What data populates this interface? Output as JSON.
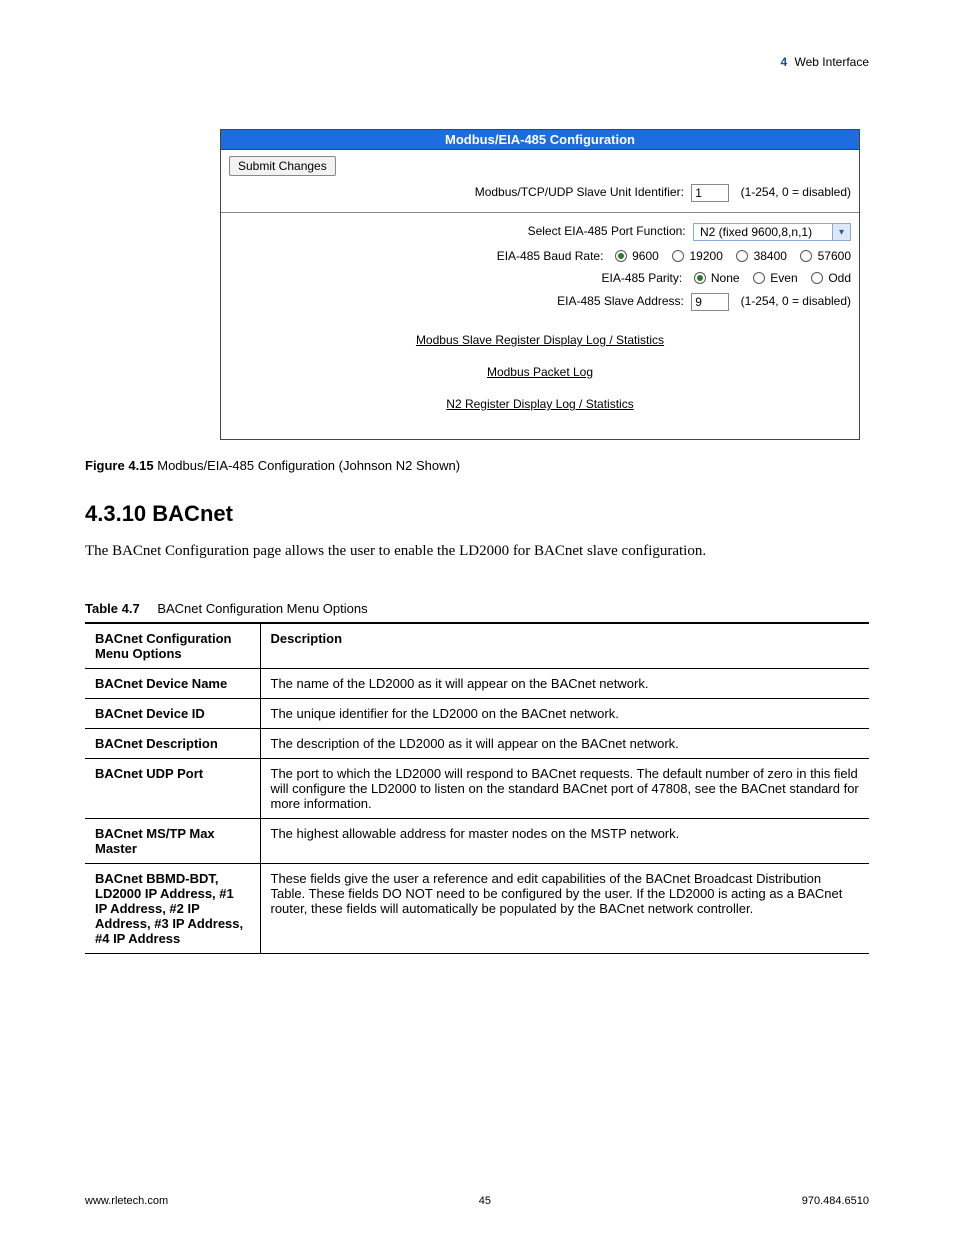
{
  "header": {
    "section_num": "4",
    "section_title": "Web Interface"
  },
  "figure": {
    "panel_title": "Modbus/EIA-485 Configuration",
    "submit_label": "Submit Changes",
    "modbus_id_label": "Modbus/TCP/UDP Slave Unit Identifier:",
    "modbus_id_value": "1",
    "modbus_id_hint": "(1-254, 0 = disabled)",
    "port_func_label": "Select EIA-485 Port Function:",
    "port_func_value": "N2 (fixed 9600,8,n,1)",
    "baud_label": "EIA-485 Baud Rate:",
    "baud_opts": [
      "9600",
      "19200",
      "38400",
      "57600"
    ],
    "parity_label": "EIA-485 Parity:",
    "parity_opts": [
      "None",
      "Even",
      "Odd"
    ],
    "slave_addr_label": "EIA-485 Slave Address:",
    "slave_addr_value": "9",
    "slave_addr_hint": "(1-254, 0 = disabled)",
    "link1": "Modbus Slave Register Display Log / Statistics",
    "link2": "Modbus Packet Log",
    "link3": "N2 Register Display Log / Statistics",
    "caption_label": "Figure 4.15",
    "caption_text": " Modbus/EIA-485 Configuration (Johnson N2 Shown)"
  },
  "section": {
    "heading": "4.3.10 BACnet",
    "body": "The BACnet Configuration page allows the user to enable the LD2000 for BACnet slave configuration."
  },
  "table": {
    "caption_label": "Table 4.7",
    "caption_text": "BACnet Configuration Menu Options",
    "head_col1": "BACnet Configuration Menu Options",
    "head_col2": "Description",
    "rows": [
      {
        "opt": "BACnet Device Name",
        "desc": "The name of the LD2000 as it will appear on the BACnet network."
      },
      {
        "opt": "BACnet Device ID",
        "desc": "The unique identifier for the LD2000 on the BACnet network."
      },
      {
        "opt": "BACnet Description",
        "desc": "The description of the LD2000 as it will appear on the BACnet network."
      },
      {
        "opt": "BACnet UDP Port",
        "desc": "The port to which the LD2000 will respond to BACnet requests. The default number of zero in this field will configure the LD2000 to listen on the standard BACnet port of 47808, see the BACnet standard for more information."
      },
      {
        "opt": "BACnet MS/TP Max Master",
        "desc": "The highest allowable address for master nodes on the MSTP network."
      },
      {
        "opt": "BACnet BBMD-BDT, LD2000 IP Address, #1 IP Address, #2 IP Address, #3 IP Address, #4 IP Address",
        "desc": "These fields give the user a reference and edit capabilities of the BACnet Broadcast Distribution Table. These fields DO NOT need to be configured by the user. If the LD2000 is acting as a BACnet router, these fields will automatically be populated by the BACnet network controller."
      }
    ]
  },
  "footer": {
    "left": "www.rletech.com",
    "center": "45",
    "right": "970.484.6510"
  }
}
